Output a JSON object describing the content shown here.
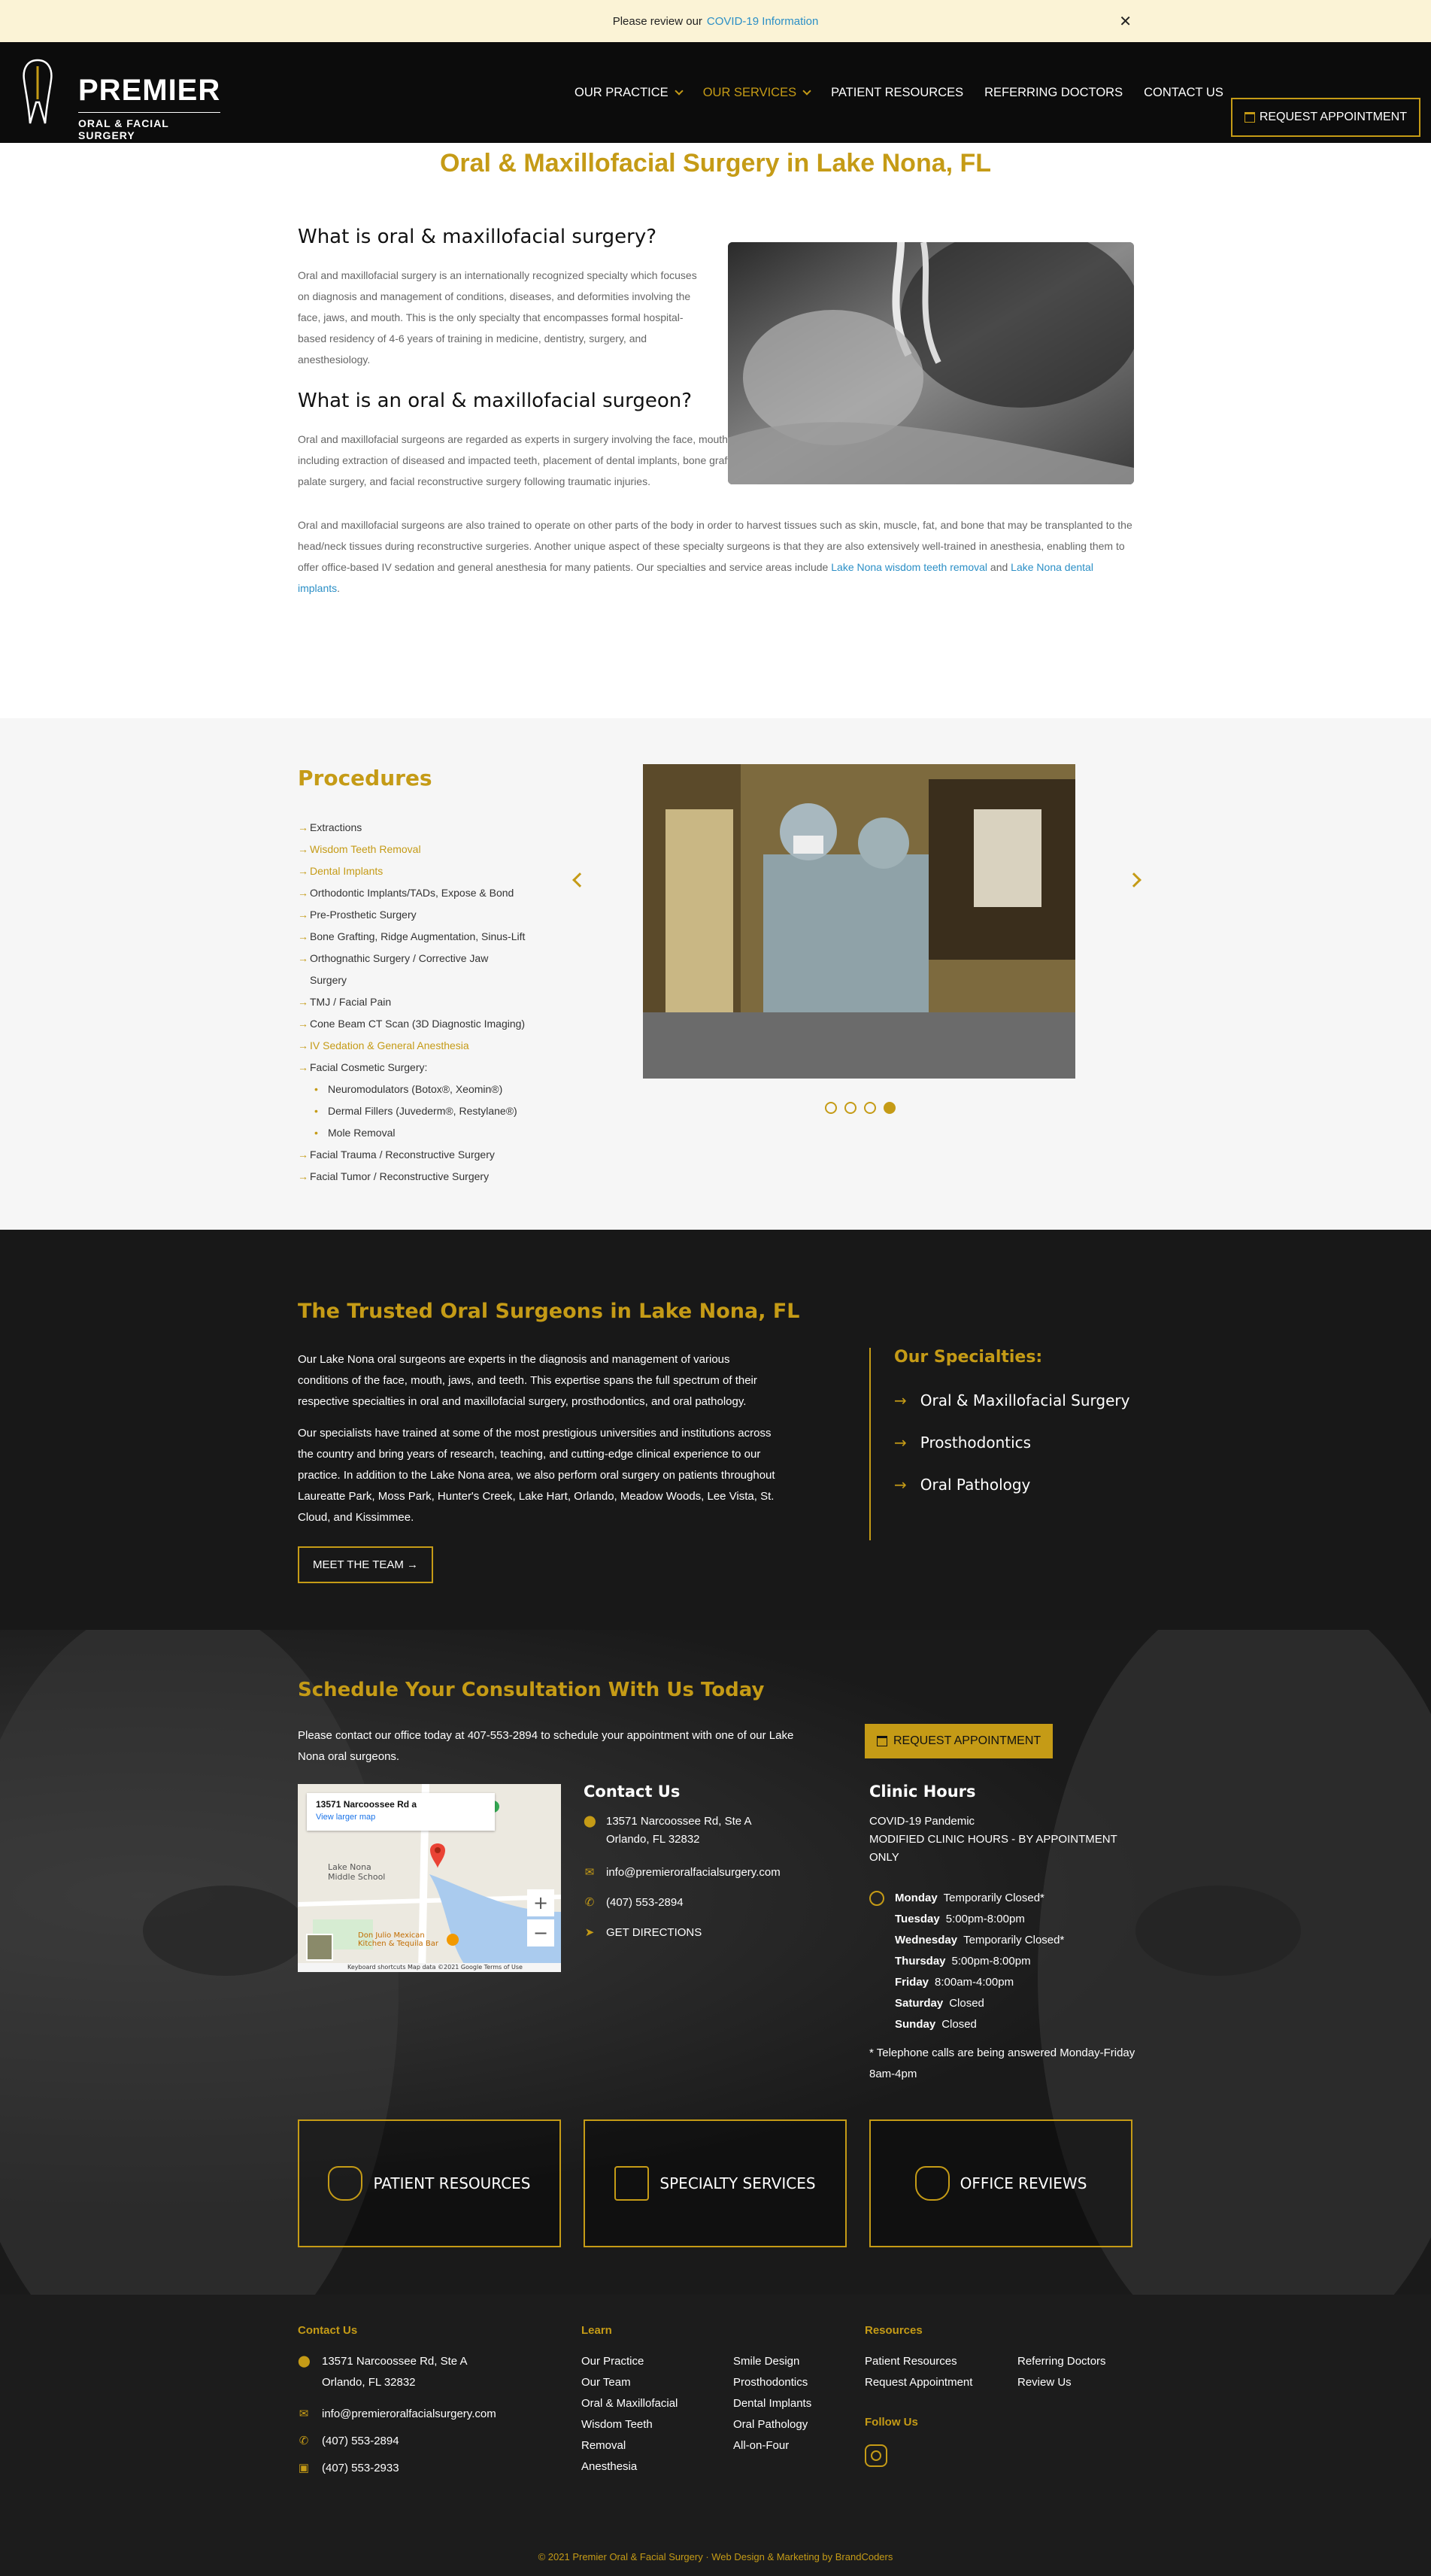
{
  "notice": {
    "text": "Please review our",
    "link": "COVID-19 Information",
    "close": "✕"
  },
  "header": {
    "logo_big": "PREMIER",
    "logo_small": "ORAL & FACIAL SURGERY",
    "nav": [
      {
        "label": "OUR PRACTICE",
        "dropdown": true,
        "active": false
      },
      {
        "label": "OUR SERVICES",
        "dropdown": true,
        "active": true
      },
      {
        "label": "PATIENT RESOURCES",
        "dropdown": false,
        "active": false
      },
      {
        "label": "REFERRING DOCTORS",
        "dropdown": false,
        "active": false
      },
      {
        "label": "CONTACT US",
        "dropdown": false,
        "active": false
      }
    ],
    "request_btn": "REQUEST APPOINTMENT"
  },
  "intro": {
    "title": "Oral & Maxillofacial Surgery in Lake Nona, FL",
    "h1": "What is oral & maxillofacial surgery?",
    "p1": "Oral and maxillofacial surgery is an internationally recognized specialty which focuses on diagnosis and management of conditions, diseases, and deformities involving the face, jaws, and mouth. This is the only specialty that encompasses formal hospital-based residency of 4-6 years of training in medicine, dentistry, surgery, and anesthesiology.",
    "h2": "What is an oral & maxillofacial surgeon?",
    "p2": "Oral and maxillofacial surgeons are regarded as experts in surgery involving the face, mouth, neck, and jaws. Our Lake Nona oral surgeons perform a wide range of operations including extraction of diseased and impacted teeth, placement of dental implants, bone grafting, corrective jaw surgery, removal of cysts and tumors, TMJ surgery, cleft lip and palate surgery, and facial reconstructive surgery following traumatic injuries.",
    "p3": "Oral and maxillofacial surgeons are also trained to operate on other parts of the body in order to harvest tissues such as skin, muscle, fat, and bone that may be transplanted to the head/neck tissues during reconstructive surgeries. Another unique aspect of these specialty surgeons is that they are also extensively well-trained in anesthesia, enabling them to offer office-based IV sedation and general anesthesia for many patients. Our specialties and service areas include",
    "p3_link1": "Lake Nona wisdom teeth removal",
    "p3_and": "and",
    "p3_link2": "Lake Nona dental implants",
    "p3_end": "."
  },
  "procedures": {
    "title": "Procedures",
    "items": [
      {
        "label": "Extractions",
        "gold": false
      },
      {
        "label": "Wisdom Teeth Removal",
        "gold": true
      },
      {
        "label": "Dental Implants",
        "gold": true
      },
      {
        "label": "Orthodontic Implants/TADs, Expose & Bond",
        "gold": false
      },
      {
        "label": "Pre-Prosthetic Surgery",
        "gold": false
      },
      {
        "label": "Bone Grafting, Ridge Augmentation, Sinus-Lift",
        "gold": false
      },
      {
        "label": "Orthognathic Surgery / Corrective Jaw Surgery",
        "gold": false
      },
      {
        "label": "TMJ / Facial Pain",
        "gold": false
      },
      {
        "label": "Cone Beam CT Scan (3D Diagnostic Imaging)",
        "gold": false
      },
      {
        "label": "IV Sedation & General Anesthesia",
        "gold": true
      },
      {
        "label": "Facial Cosmetic Surgery:",
        "gold": false
      }
    ],
    "sub_items": [
      "Neuromodulators (Botox®, Xeomin®)",
      "Dermal Fillers (Juvederm®, Restylane®)",
      "Mole Removal"
    ],
    "items_after": [
      "Facial Trauma / Reconstructive Surgery",
      "Facial Tumor / Reconstructive Surgery"
    ],
    "slider_active": 4,
    "slider_count": 4
  },
  "trusted": {
    "title": "The Trusted Oral Surgeons in Lake Nona, FL",
    "p1": "Our Lake Nona oral surgeons are experts in the diagnosis and management of various conditions of the face, mouth, jaws, and teeth. This expertise spans the full spectrum of their respective specialties in oral and maxillofacial surgery, prosthodontics, and oral pathology.",
    "p2": "Our specialists have trained at some of the most prestigious universities and institutions across the country and bring years of research, teaching, and cutting-edge clinical experience to our practice. In addition to the Lake Nona area, we also perform oral surgery on patients throughout Laureatte Park, Moss Park, Hunter's Creek, Lake Hart, Orlando, Meadow Woods, Lee Vista, St. Cloud, and Kissimmee.",
    "btn": "MEET THE TEAM →",
    "spec_title": "Our Specialties:",
    "specialties": [
      "Oral & Maxillofacial Surgery",
      "Prosthodontics",
      "Oral Pathology"
    ]
  },
  "schedule": {
    "title": "Schedule Your Consultation With Us Today",
    "para": "Please contact our office today at 407-553-2894 to schedule your appointment with one of our Lake Nona oral surgeons.",
    "btn": "REQUEST APPOINTMENT",
    "map_place": "13571 Narcoossee Rd a",
    "map_link": "View larger map",
    "map_label1": "Lake Nona Middle School",
    "map_label2": "Don Julio Mexican Kitchen & Tequila Bar",
    "map_footer": "Keyboard shortcuts   Map data ©2021 Google   Terms of Use",
    "contact_title": "Contact Us",
    "addr1": "13571 Narcoossee Rd, Ste A",
    "addr2": "Orlando, FL 32832",
    "email": "info@premieroralfacialsurgery.com",
    "phone": "(407) 553-2894",
    "directions": "GET DIRECTIONS",
    "hours_title": "Clinic Hours",
    "hours_intro1": "COVID-19 Pandemic",
    "hours_intro2": "MODIFIED CLINIC HOURS - BY APPOINTMENT ONLY",
    "hours": [
      {
        "day": "Monday",
        "time": "Temporarily Closed*"
      },
      {
        "day": "Tuesday",
        "time": "5:00pm-8:00pm"
      },
      {
        "day": "Wednesday",
        "time": "Temporarily Closed*"
      },
      {
        "day": "Thursday",
        "time": "5:00pm-8:00pm"
      },
      {
        "day": "Friday",
        "time": "8:00am-4:00pm"
      },
      {
        "day": "Saturday",
        "time": "Closed"
      },
      {
        "day": "Sunday",
        "time": "Closed"
      }
    ],
    "hours_note": "* Telephone calls are being answered Monday-Friday 8am-4pm",
    "cards": [
      "PATIENT RESOURCES",
      "SPECIALTY SERVICES",
      "OFFICE REVIEWS"
    ]
  },
  "footer": {
    "contact_h": "Contact Us",
    "addr1": "13571 Narcoossee Rd, Ste A",
    "addr2": "Orlando, FL 32832",
    "email": "info@premieroralfacialsurgery.com",
    "phone": "(407) 553-2894",
    "fax": "(407) 553-2933",
    "learn_h": "Learn",
    "learn1": [
      "Our Practice",
      "Our Team",
      "Oral & Maxillofacial",
      "Wisdom Teeth Removal",
      "Anesthesia"
    ],
    "learn2": [
      "Smile Design",
      "Prosthodontics",
      "Dental Implants",
      "Oral Pathology",
      "All-on-Four"
    ],
    "resources_h": "Resources",
    "res1": [
      "Patient Resources",
      "Request Appointment"
    ],
    "res2": [
      "Referring Doctors",
      "Review Us"
    ],
    "follow_h": "Follow Us",
    "copyright": "© 2021 Premier Oral & Facial Surgery · Web Design & Marketing by BrandCoders"
  },
  "colors": {
    "gold": "#c59b16",
    "dark": "#181818",
    "link": "#2b8fc6"
  }
}
